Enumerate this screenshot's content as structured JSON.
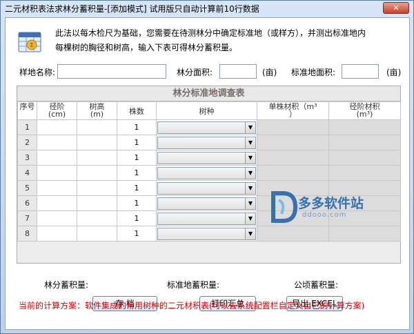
{
  "window": {
    "title": "二元材积表法求林分蓄积量-[添加模式] 试用版只自动计算前10行数据",
    "close_label": "✕"
  },
  "intro": {
    "line1": "此法以每木检尺为基础，您需要在待测林分中确定标准地（或样方），并测出标准地内",
    "line2": "每棵树的胸径和树高，输入下表可得林分蓄积量。"
  },
  "form": {
    "plot_name_label": "样地名称:",
    "plot_name_value": "",
    "stand_area_label": "林分面积:",
    "stand_area_value": "",
    "stand_area_unit": "(亩)",
    "plot_area_label": "标准地面积:",
    "plot_area_value": "",
    "plot_area_unit": "(亩)"
  },
  "table": {
    "caption": "林分标准地调查表",
    "headers": {
      "idx": "序号",
      "diameter": "径阶",
      "diameter_unit": "(cm)",
      "height": "树高",
      "height_unit": "(m)",
      "count": "株数",
      "species": "树种",
      "single_volume": "单株材积（m³",
      "single_volume_tail": "）",
      "class_volume": "径阶材积",
      "class_volume_unit": "(m³)"
    },
    "rows": [
      {
        "idx": "1",
        "count": "1"
      },
      {
        "idx": "2",
        "count": "1"
      },
      {
        "idx": "3",
        "count": "1"
      },
      {
        "idx": "4",
        "count": "1"
      },
      {
        "idx": "5",
        "count": "1"
      },
      {
        "idx": "6",
        "count": "1"
      },
      {
        "idx": "7",
        "count": "1"
      },
      {
        "idx": "8",
        "count": "1"
      }
    ]
  },
  "watermark": {
    "text": "多多软件站",
    "sub": "ddooo.com"
  },
  "summary": {
    "stand_volume_label": "林分蓄积量:",
    "plot_volume_label": "标准地蓄积量:",
    "per_ha_label": "公顷蓄积量:"
  },
  "buttons": {
    "save": "存 档",
    "print": "打印汇总",
    "export": "导出 EXCEL"
  },
  "footer": {
    "text": "当前的计算方案：软件集成的常用树种的二元材积表(可以去系统配置栏自定义自己的计算方案)"
  },
  "colors": {
    "accent": "#d90000",
    "watermark": "#1b5fa8"
  }
}
